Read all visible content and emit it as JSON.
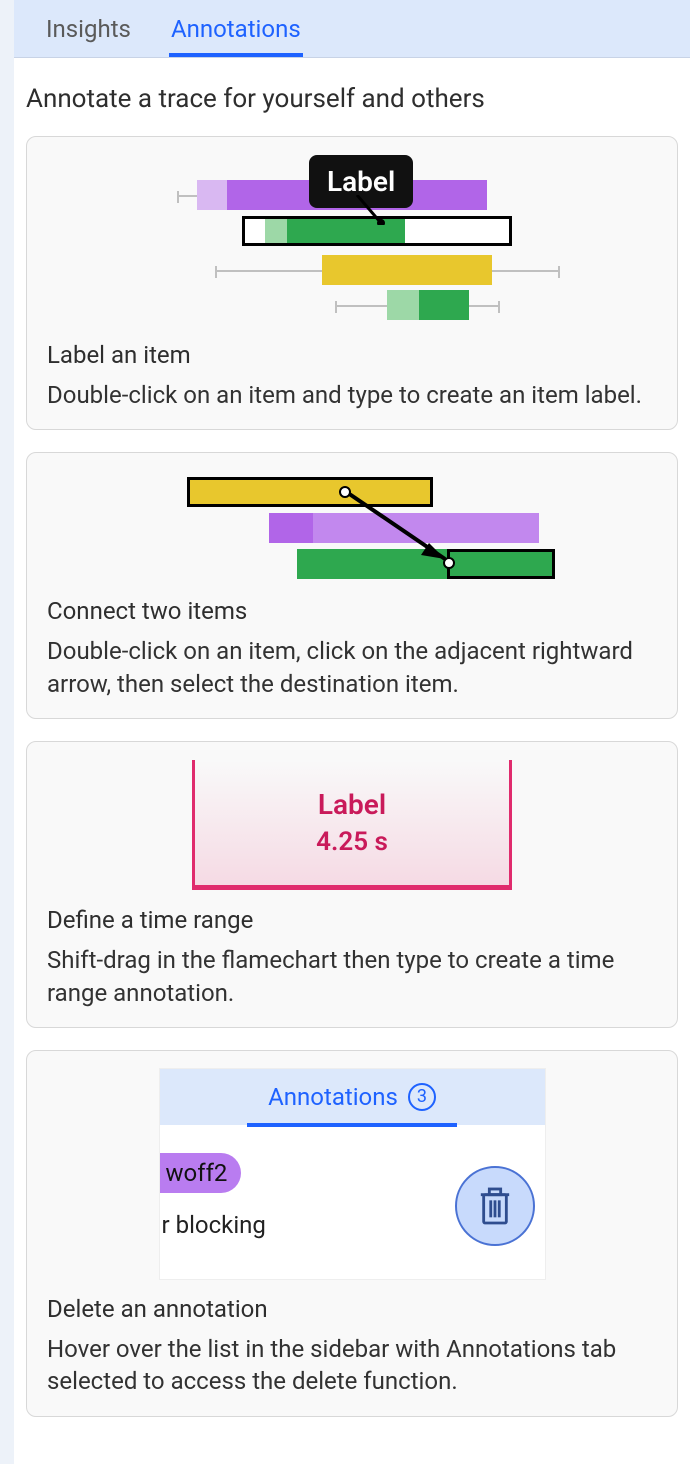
{
  "tabs": {
    "insights": "Insights",
    "annotations": "Annotations"
  },
  "page_title": "Annotate a trace for yourself and others",
  "card1": {
    "tooltip": "Label",
    "heading": "Label an item",
    "desc": "Double-click on an item and type to create an item label."
  },
  "card2": {
    "heading": "Connect two items",
    "desc": "Double-click on an item, click on the adjacent rightward arrow, then select the destination item."
  },
  "card3": {
    "label": "Label",
    "time": "4.25 s",
    "heading": "Define a time range",
    "desc": "Shift-drag in the flamechart then type to create a time range annotation."
  },
  "card4": {
    "mini_tab": "Annotations",
    "mini_badge": "3",
    "chip": "woff2",
    "row2": "r blocking",
    "heading": "Delete an annotation",
    "desc": "Hover over the list in the sidebar with Annotations tab selected to access the delete function."
  }
}
